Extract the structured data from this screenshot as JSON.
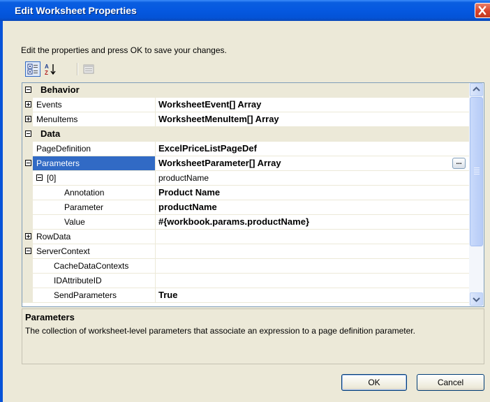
{
  "window": {
    "title": "Edit Worksheet Properties"
  },
  "instructions": "Edit the properties and press OK to save your changes.",
  "toolbar": {
    "buttons": [
      {
        "name": "categorized-icon"
      },
      {
        "name": "alphabetical-icon"
      },
      {
        "name": "property-pages-icon"
      }
    ]
  },
  "property_grid": {
    "categories": {
      "behavior": "Behavior",
      "data": "Data"
    },
    "rows": {
      "events": {
        "name": "Events",
        "value": "WorksheetEvent[] Array"
      },
      "menuitems": {
        "name": "MenuItems",
        "value": "WorksheetMenuItem[] Array"
      },
      "pagedefinition": {
        "name": "PageDefinition",
        "value": "ExcelPriceListPageDef"
      },
      "parameters": {
        "name": "Parameters",
        "value": "WorksheetParameter[] Array",
        "button": "..."
      },
      "index0": {
        "name": "[0]",
        "value": "productName"
      },
      "annotation": {
        "name": "Annotation",
        "value": "Product Name"
      },
      "parameter": {
        "name": "Parameter",
        "value": "productName"
      },
      "value": {
        "name": "Value",
        "value": "#{workbook.params.productName}"
      },
      "rowdata": {
        "name": "RowData",
        "value": ""
      },
      "servercontext": {
        "name": "ServerContext",
        "value": ""
      },
      "cachedatacontexts": {
        "name": "CacheDataContexts",
        "value": ""
      },
      "idattributeid": {
        "name": "IDAttributeID",
        "value": ""
      },
      "sendparameters": {
        "name": "SendParameters",
        "value": "True"
      }
    }
  },
  "description": {
    "title": "Parameters",
    "text": "The collection of worksheet-level parameters that associate an expression to a page definition parameter."
  },
  "buttons": {
    "ok": "OK",
    "cancel": "Cancel"
  },
  "colors": {
    "title_bar": "#0558e0",
    "selection": "#316ac5",
    "dialog_background": "#ece9d8"
  }
}
